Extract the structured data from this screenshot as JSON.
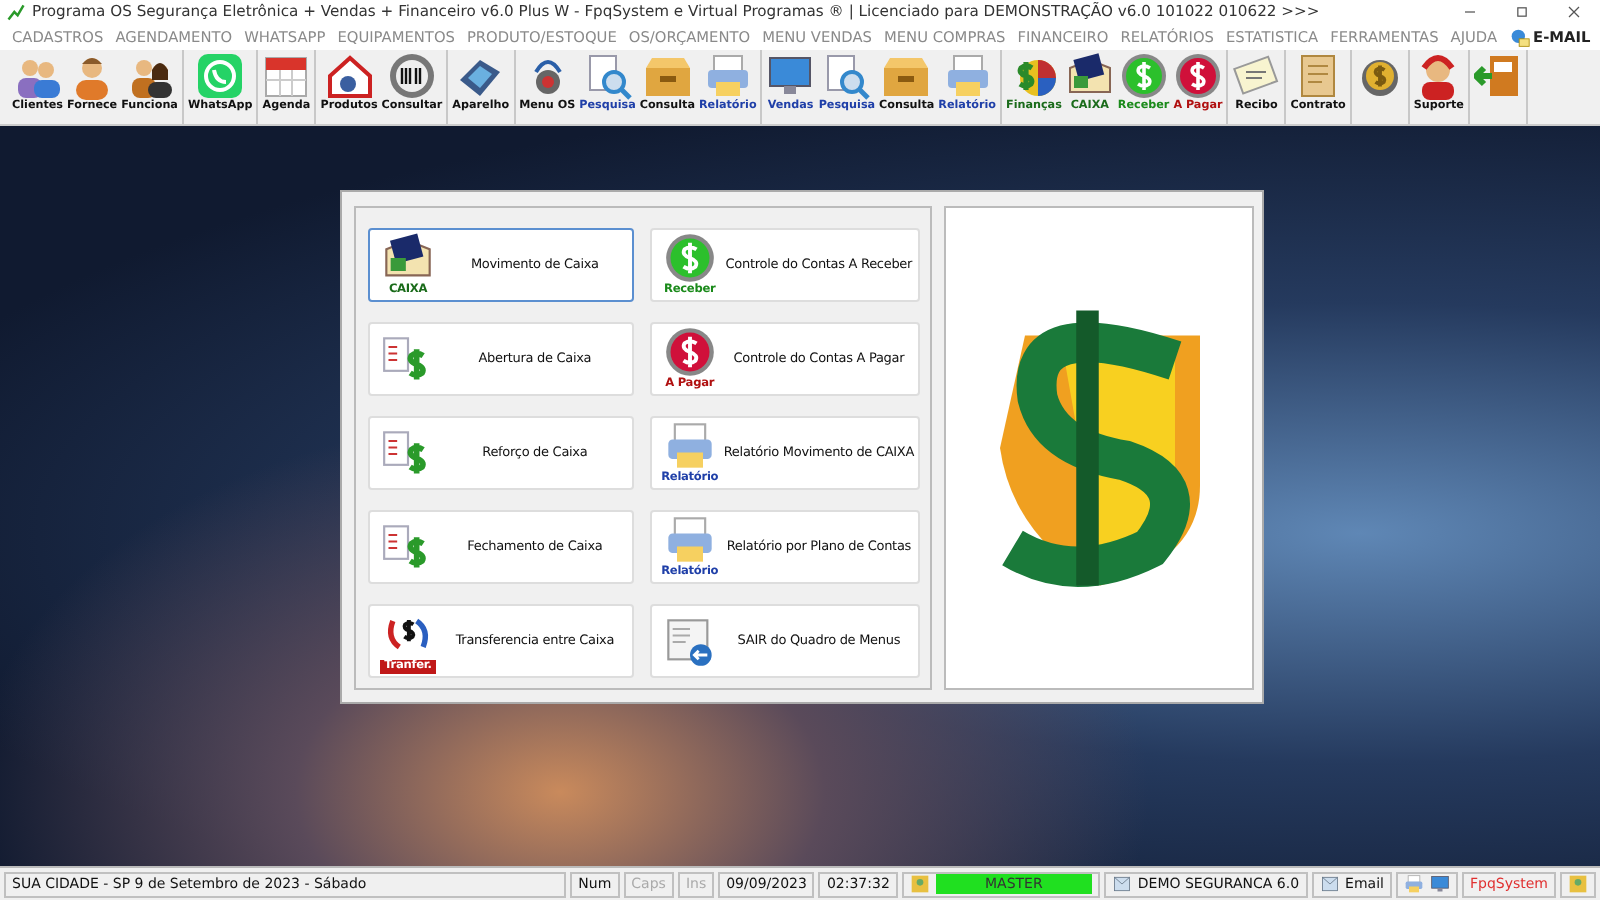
{
  "window": {
    "title": "Programa OS Segurança Eletrônica + Vendas + Financeiro v6.0 Plus W - FpqSystem e Virtual Programas ® | Licenciado para  DEMONSTRAÇÃO v6.0 101022 010622 >>>"
  },
  "menu": [
    {
      "label": "CADASTROS",
      "kind": "plain"
    },
    {
      "label": "AGENDAMENTO",
      "kind": "plain"
    },
    {
      "label": "WHATSAPP",
      "kind": "plain"
    },
    {
      "label": "EQUIPAMENTOS",
      "kind": "plain"
    },
    {
      "label": "PRODUTO/ESTOQUE",
      "kind": "plain"
    },
    {
      "label": "OS/ORÇAMENTO",
      "kind": "plain"
    },
    {
      "label": "MENU VENDAS",
      "kind": "plain"
    },
    {
      "label": "MENU COMPRAS",
      "kind": "plain"
    },
    {
      "label": "FINANCEIRO",
      "kind": "plain"
    },
    {
      "label": "RELATÓRIOS",
      "kind": "plain"
    },
    {
      "label": "ESTATISTICA",
      "kind": "plain"
    },
    {
      "label": "FERRAMENTAS",
      "kind": "plain"
    },
    {
      "label": "AJUDA",
      "kind": "plain"
    },
    {
      "label": "E-MAIL",
      "kind": "email"
    }
  ],
  "toolbar": [
    {
      "kind": "buttons",
      "items": [
        {
          "label": "Clientes"
        },
        {
          "label": "Fornece"
        },
        {
          "label": "Funciona"
        }
      ]
    },
    {
      "kind": "buttons",
      "items": [
        {
          "label": "WhatsApp"
        }
      ]
    },
    {
      "kind": "buttons",
      "items": [
        {
          "label": "Agenda"
        }
      ]
    },
    {
      "kind": "buttons",
      "items": [
        {
          "label": "Produtos"
        },
        {
          "label": "Consultar"
        }
      ]
    },
    {
      "kind": "buttons",
      "items": [
        {
          "label": "Aparelho"
        }
      ]
    },
    {
      "kind": "buttons",
      "items": [
        {
          "label": "Menu OS"
        },
        {
          "label": "Pesquisa",
          "color": "#1f3fa8"
        },
        {
          "label": "Consulta"
        },
        {
          "label": "Relatório",
          "color": "#1f3fa8"
        }
      ]
    },
    {
      "kind": "buttons",
      "items": [
        {
          "label": "Vendas",
          "color": "#1f3fa8"
        },
        {
          "label": "Pesquisa",
          "color": "#1f3fa8"
        },
        {
          "label": "Consulta"
        },
        {
          "label": "Relatório",
          "color": "#1f3fa8"
        }
      ]
    },
    {
      "kind": "buttons",
      "items": [
        {
          "label": "Finanças",
          "color": "#1a6b1a"
        },
        {
          "label": "CAIXA",
          "color": "#1a6b1a"
        },
        {
          "label": "Receber",
          "color": "#1a8a1a"
        },
        {
          "label": "A Pagar",
          "color": "#b01010"
        }
      ]
    },
    {
      "kind": "buttons",
      "items": [
        {
          "label": "Recibo"
        }
      ]
    },
    {
      "kind": "buttons",
      "items": [
        {
          "label": "Contrato"
        }
      ]
    },
    {
      "kind": "icon_button"
    },
    {
      "kind": "buttons",
      "items": [
        {
          "label": "Suporte"
        }
      ]
    },
    {
      "kind": "icon_button"
    }
  ],
  "dialog": {
    "buttons": [
      {
        "label": "Movimento de Caixa",
        "icon_label": "CAIXA",
        "selected": true
      },
      {
        "label": "Controle do Contas A Receber",
        "icon_label": "Receber",
        "selected": false
      },
      {
        "label": "Abertura de Caixa",
        "selected": false
      },
      {
        "label": "Controle do Contas A Pagar",
        "icon_label": "A Pagar",
        "selected": false
      },
      {
        "label": "Reforço de Caixa",
        "selected": false
      },
      {
        "label": "Relatório Movimento de CAIXA",
        "icon_label": "Relatório",
        "selected": false
      },
      {
        "label": "Fechamento de Caixa",
        "selected": false
      },
      {
        "label": "Relatório por Plano de Contas",
        "icon_label": "Relatório",
        "selected": false
      },
      {
        "label": "Transferencia entre Caixa",
        "icon_label": "Tranfer.",
        "selected": false
      },
      {
        "label": "SAIR do Quadro de Menus",
        "selected": false
      }
    ]
  },
  "status_bar": [
    {
      "kind": "text",
      "text": "SUA CIDADE - SP  9 de Setembro de 2023 - Sábado"
    },
    {
      "kind": "key",
      "text": "Num",
      "on": true
    },
    {
      "kind": "key",
      "text": "Caps",
      "on": false
    },
    {
      "kind": "key",
      "text": "Ins",
      "on": false
    },
    {
      "kind": "plain",
      "text": "09/09/2023"
    },
    {
      "kind": "plain",
      "text": "02:37:32"
    },
    {
      "kind": "meter",
      "text": "MASTER",
      "level": 1
    },
    {
      "kind": "icon_text",
      "text": "DEMO SEGURANCA 6.0"
    },
    {
      "kind": "icon_text",
      "text": "Email"
    },
    {
      "kind": "icons"
    },
    {
      "kind": "brand",
      "text": "FpqSystem"
    },
    {
      "kind": "icon"
    }
  ]
}
